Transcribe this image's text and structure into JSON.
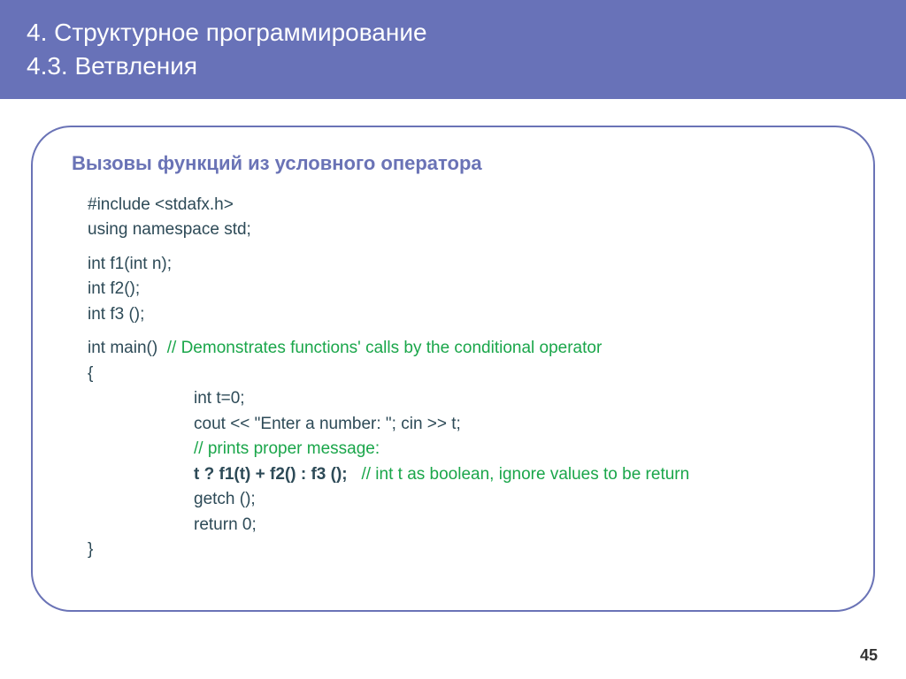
{
  "header": {
    "line1": "4. Структурное программирование",
    "line2": "4.3. Ветвления"
  },
  "subheading": "Вызовы функций из условного оператора",
  "code": {
    "l1": "#include <stdafx.h>",
    "l2": "using namespace std;",
    "l3": "int f1(int n);",
    "l4": "int f2();",
    "l5": "int f3 ();",
    "l6a": "int main()",
    "l6b": "// Demonstrates functions' calls by the conditional operator",
    "l7": "{",
    "l8": "int t=0;",
    "l9": "cout << \"Enter a number: \"; cin >> t;",
    "l10": "// prints proper message:",
    "l11a": "t ? f1(t) + f2() : f3 ();",
    "l11b": "// int t as boolean, ignore values to be return",
    "l12": "getch ();",
    "l13": "return 0;",
    "l14": "}"
  },
  "page_number": "45"
}
